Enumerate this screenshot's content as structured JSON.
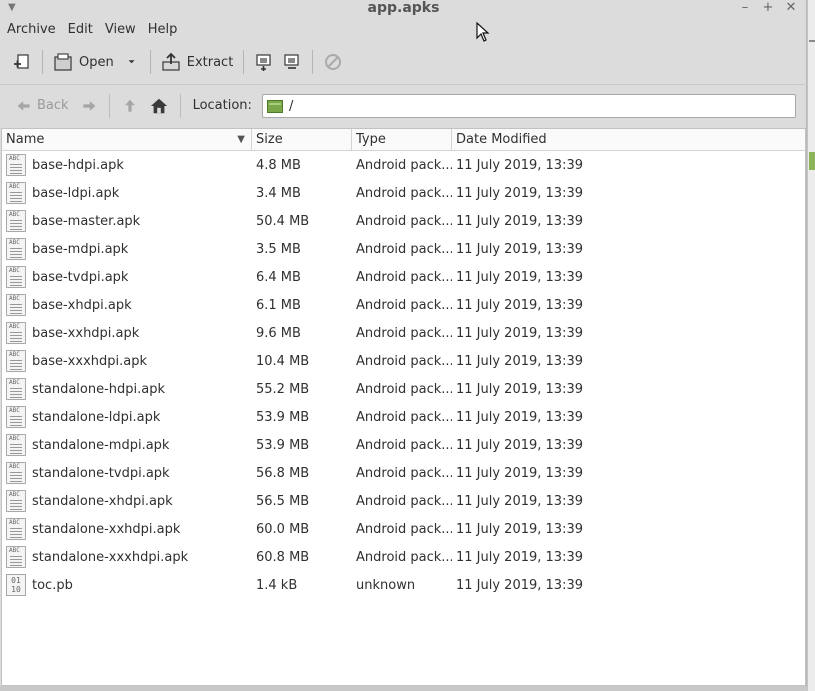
{
  "window": {
    "title": "app.apks"
  },
  "menu": [
    "Archive",
    "Edit",
    "View",
    "Help"
  ],
  "toolbar": {
    "open_label": "Open",
    "extract_label": "Extract"
  },
  "nav": {
    "back_label": "Back",
    "location_label": "Location:",
    "location_value": "/"
  },
  "columns": {
    "name": "Name",
    "size": "Size",
    "type": "Type",
    "date": "Date Modified"
  },
  "files": [
    {
      "name": "base-hdpi.apk",
      "size": "4.8 MB",
      "type": "Android pack...",
      "date": "11 July 2019, 13:39",
      "icon": "text"
    },
    {
      "name": "base-ldpi.apk",
      "size": "3.4 MB",
      "type": "Android pack...",
      "date": "11 July 2019, 13:39",
      "icon": "text"
    },
    {
      "name": "base-master.apk",
      "size": "50.4 MB",
      "type": "Android pack...",
      "date": "11 July 2019, 13:39",
      "icon": "text"
    },
    {
      "name": "base-mdpi.apk",
      "size": "3.5 MB",
      "type": "Android pack...",
      "date": "11 July 2019, 13:39",
      "icon": "text"
    },
    {
      "name": "base-tvdpi.apk",
      "size": "6.4 MB",
      "type": "Android pack...",
      "date": "11 July 2019, 13:39",
      "icon": "text"
    },
    {
      "name": "base-xhdpi.apk",
      "size": "6.1 MB",
      "type": "Android pack...",
      "date": "11 July 2019, 13:39",
      "icon": "text"
    },
    {
      "name": "base-xxhdpi.apk",
      "size": "9.6 MB",
      "type": "Android pack...",
      "date": "11 July 2019, 13:39",
      "icon": "text"
    },
    {
      "name": "base-xxxhdpi.apk",
      "size": "10.4 MB",
      "type": "Android pack...",
      "date": "11 July 2019, 13:39",
      "icon": "text"
    },
    {
      "name": "standalone-hdpi.apk",
      "size": "55.2 MB",
      "type": "Android pack...",
      "date": "11 July 2019, 13:39",
      "icon": "text"
    },
    {
      "name": "standalone-ldpi.apk",
      "size": "53.9 MB",
      "type": "Android pack...",
      "date": "11 July 2019, 13:39",
      "icon": "text"
    },
    {
      "name": "standalone-mdpi.apk",
      "size": "53.9 MB",
      "type": "Android pack...",
      "date": "11 July 2019, 13:39",
      "icon": "text"
    },
    {
      "name": "standalone-tvdpi.apk",
      "size": "56.8 MB",
      "type": "Android pack...",
      "date": "11 July 2019, 13:39",
      "icon": "text"
    },
    {
      "name": "standalone-xhdpi.apk",
      "size": "56.5 MB",
      "type": "Android pack...",
      "date": "11 July 2019, 13:39",
      "icon": "text"
    },
    {
      "name": "standalone-xxhdpi.apk",
      "size": "60.0 MB",
      "type": "Android pack...",
      "date": "11 July 2019, 13:39",
      "icon": "text"
    },
    {
      "name": "standalone-xxxhdpi.apk",
      "size": "60.8 MB",
      "type": "Android pack...",
      "date": "11 July 2019, 13:39",
      "icon": "text"
    },
    {
      "name": "toc.pb",
      "size": "1.4 kB",
      "type": "unknown",
      "date": "11 July 2019, 13:39",
      "icon": "binary"
    }
  ],
  "icon_text_glyph": "ABC",
  "icon_binary_glyph_1": "01",
  "icon_binary_glyph_2": "10",
  "colors": {
    "folder_green": "#7aa74a",
    "list_bg": "#ffffff",
    "window_bg": "#dcdcdc"
  }
}
